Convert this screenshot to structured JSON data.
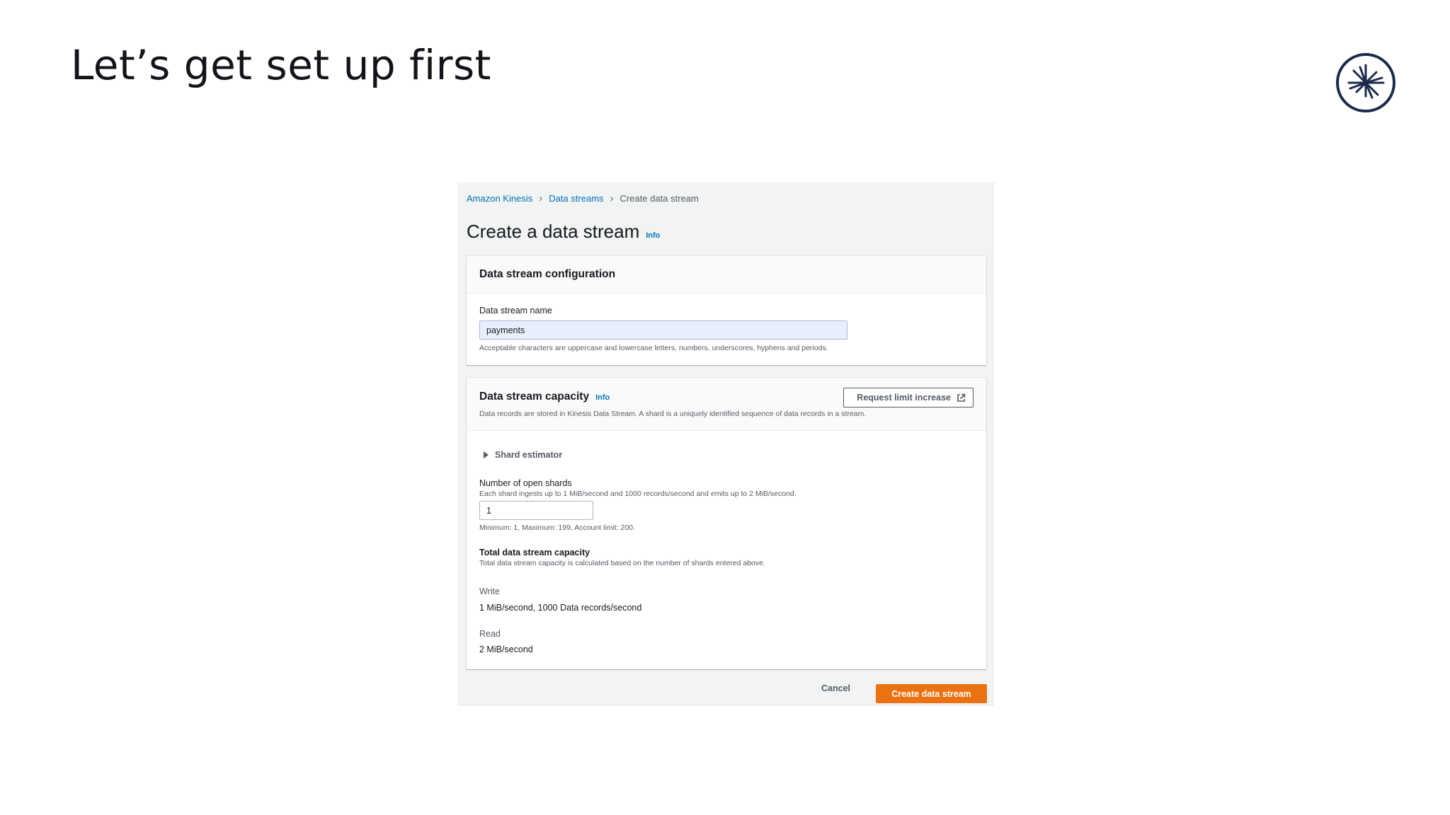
{
  "slide": {
    "title": "Let’s get set up first"
  },
  "logo": {
    "icon": "starburst-logo-icon",
    "color": "#1b2b4b"
  },
  "breadcrumb": {
    "items": [
      "Amazon Kinesis",
      "Data streams"
    ],
    "current": "Create data stream"
  },
  "page": {
    "heading": "Create a data stream",
    "info": "Info"
  },
  "config_card": {
    "title": "Data stream configuration",
    "name_label": "Data stream name",
    "name_value": "payments",
    "name_hint": "Acceptable characters are uppercase and lowercase letters, numbers, underscores, hyphens and periods."
  },
  "capacity_card": {
    "title": "Data stream capacity",
    "info": "Info",
    "description": "Data records are stored in Kinesis Data Stream. A shard is a uniquely identified sequence of data records in a stream.",
    "limit_button": "Request limit increase",
    "shard_estimator": "Shard estimator",
    "shards_label": "Number of open shards",
    "shards_description": "Each shard ingests up to 1 MiB/second and 1000 records/second and emits up to 2 MiB/second.",
    "shards_value": "1",
    "shards_hint": "Minimum: 1, Maximum: 199, Account limit: 200.",
    "total_title": "Total data stream capacity",
    "total_description": "Total data stream capacity is calculated based on the number of shards entered above.",
    "write_label": "Write",
    "write_value": "1 MiB/second, 1000 Data records/second",
    "read_label": "Read",
    "read_value": "2 MiB/second"
  },
  "footer": {
    "cancel": "Cancel",
    "create": "Create data stream"
  },
  "colors": {
    "link": "#0073bb",
    "primary_button": "#ec7211",
    "panel_background": "#f2f3f3"
  }
}
